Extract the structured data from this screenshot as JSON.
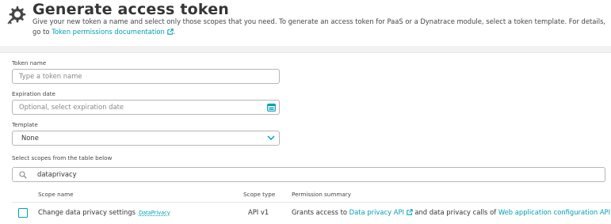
{
  "header": {
    "title": "Generate access token",
    "description": "Give your new token a name and select only those scopes that you need. To generate an access token for PaaS or a Dynatrace module, select a token template. For details, go to",
    "doc_link": "Token permissions documentation",
    "doc_link_suffix": "."
  },
  "form": {
    "token_name": {
      "label": "Token name",
      "placeholder": "Type a token name"
    },
    "expiration": {
      "label": "Expiration date",
      "placeholder": "Optional, select expiration date"
    },
    "template": {
      "label": "Template",
      "value": "None"
    },
    "scopes": {
      "label": "Select scopes from the table below",
      "search_value": "dataprivacy"
    }
  },
  "table": {
    "headers": {
      "name": "Scope name",
      "type": "Scope type",
      "summary": "Permission summary"
    },
    "rows": [
      {
        "name": "Change data privacy settings",
        "tag": "DataPrivacy",
        "type": "API v1",
        "summary_prefix": "Grants access to",
        "summary_link1": "Data privacy API",
        "summary_mid": "and data privacy calls of",
        "summary_link2": "Web application configuration API",
        "summary_suffix": "."
      }
    ]
  },
  "colors": {
    "accent": "#00a1b2",
    "text": "#353535",
    "icon": "#454646"
  }
}
